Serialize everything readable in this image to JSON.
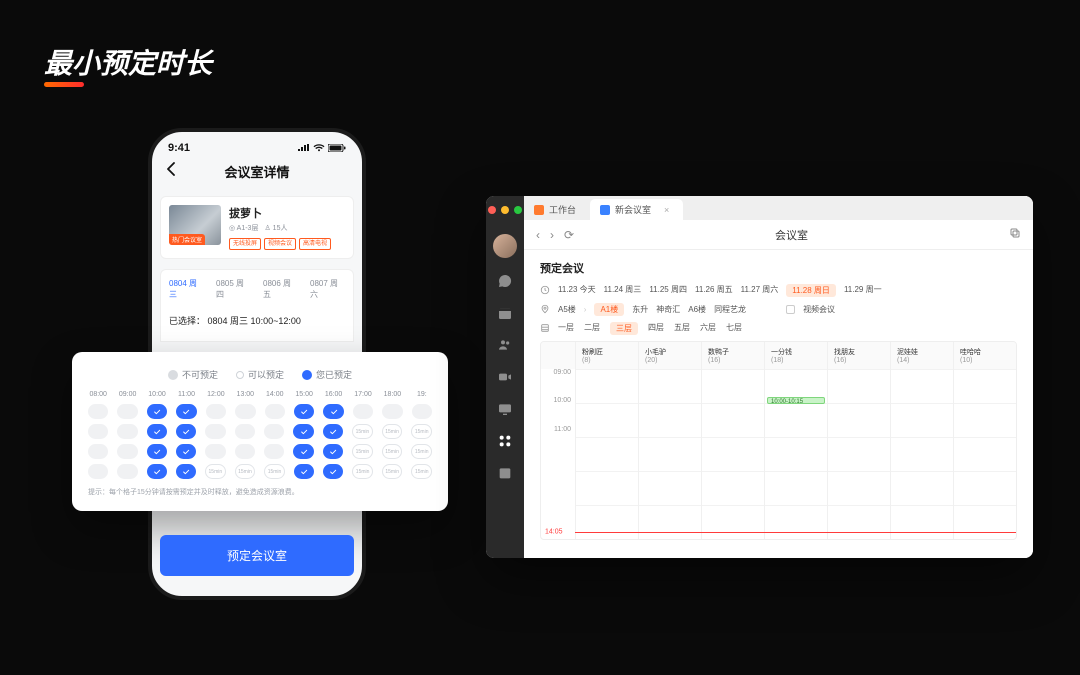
{
  "title": "最小预定时长",
  "phone": {
    "status_time": "9:41",
    "nav_title": "会议室详情",
    "room": {
      "name": "拔萝卜",
      "img_badge": "热门会议室",
      "loc": "◎ A1-3层",
      "cap": "♙ 15人",
      "tags": [
        "无线投屏",
        "视频会议",
        "高清电视"
      ]
    },
    "date_tabs": [
      "0804 周三",
      "0805 周四",
      "0806 周五",
      "0807 周六"
    ],
    "active_date_tab": 0,
    "selected_label": "已选择：",
    "selected_value": "0804 周三  10:00~12:00",
    "slot_card": {
      "legend_unavail": "不可预定",
      "legend_avail": "可以预定",
      "legend_sel": "您已预定",
      "hours": [
        "08:00",
        "09:00",
        "10:00",
        "11:00",
        "12:00",
        "13:00",
        "14:00",
        "15:00",
        "16:00",
        "17:00",
        "18:00",
        "19:"
      ],
      "avail_label": "15min",
      "tip": "提示：每个格子15分钟请按需预定并及时释放，避免造成资源浪费。",
      "grid": [
        [
          "u",
          "u",
          "s",
          "s",
          "u",
          "u",
          "u",
          "s",
          "s",
          "u",
          "u",
          "u"
        ],
        [
          "u",
          "u",
          "s",
          "s",
          "u",
          "u",
          "u",
          "s",
          "s",
          "a",
          "a",
          "a"
        ],
        [
          "u",
          "u",
          "s",
          "s",
          "u",
          "u",
          "u",
          "s",
          "s",
          "a",
          "a",
          "a"
        ],
        [
          "u",
          "u",
          "s",
          "s",
          "a",
          "a",
          "a",
          "s",
          "s",
          "a",
          "a",
          "a"
        ]
      ]
    },
    "cta": "预定会议室"
  },
  "mac": {
    "tabs": [
      {
        "label": "工作台",
        "active": false,
        "color": "orange"
      },
      {
        "label": "新会议室",
        "active": true,
        "color": "blue"
      }
    ],
    "toolbar_title": "会议室",
    "sect_title": "预定会议",
    "date_filters": [
      "11.23 今天",
      "11.24 周三",
      "11.25 周四",
      "11.26 周五",
      "11.27 周六",
      "11.28 周日",
      "11.29 周一"
    ],
    "active_date_filter": 5,
    "building_filters": [
      "A5楼",
      "A1楼",
      "东升",
      "神奇汇",
      "A6楼",
      "同程艺龙"
    ],
    "active_building_filter": 1,
    "video_label": "视频会议",
    "floor_filters": [
      "一层",
      "二层",
      "三层",
      "四层",
      "五层",
      "六层",
      "七层"
    ],
    "active_floor_filter": 2,
    "rooms": [
      {
        "name": "粉刷匠",
        "cap": "(8)"
      },
      {
        "name": "小毛驴",
        "cap": "(20)"
      },
      {
        "name": "数鸭子",
        "cap": "(16)"
      },
      {
        "name": "一分钱",
        "cap": "(18)"
      },
      {
        "name": "找朋友",
        "cap": "(16)"
      },
      {
        "name": "泥娃娃",
        "cap": "(14)"
      },
      {
        "name": "哇哈哈",
        "cap": "(10)"
      }
    ],
    "time_rows": [
      "09:00",
      "10:00",
      "11:00",
      "",
      "",
      ""
    ],
    "now_label": "14:05",
    "event_label": "10:00-10:15"
  }
}
